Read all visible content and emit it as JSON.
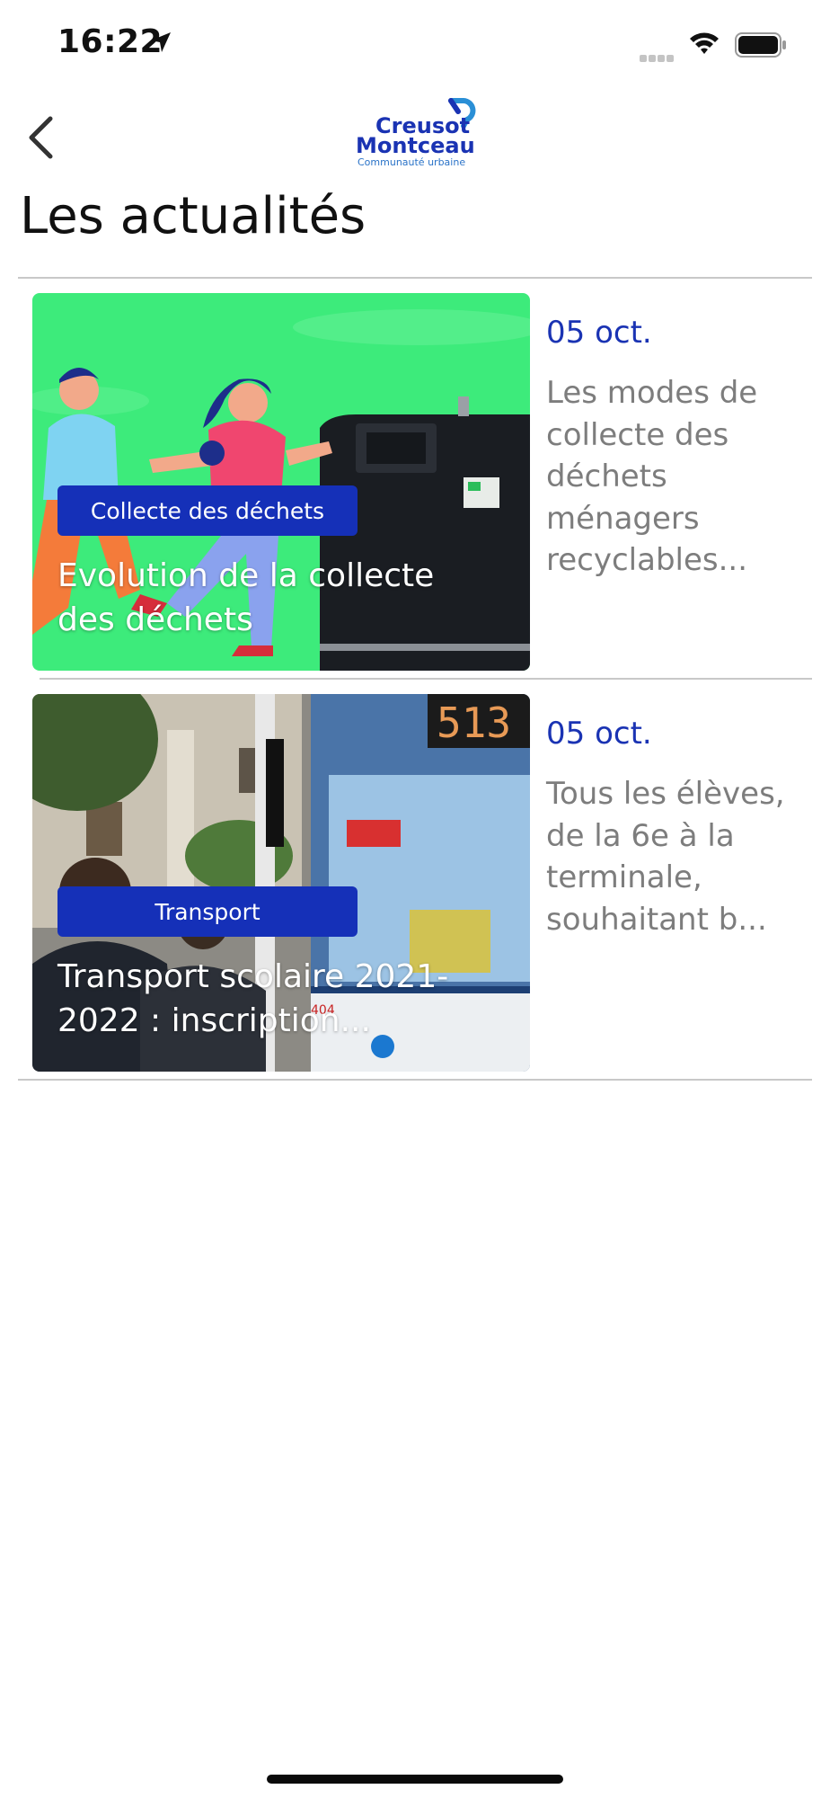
{
  "status_bar": {
    "time": "16:22",
    "icons": [
      "location-arrow-icon",
      "cellular-signal-icon",
      "wifi-icon",
      "battery-icon"
    ]
  },
  "nav": {
    "back_icon": "chevron-left-icon",
    "logo": {
      "line1": "Creusot",
      "line2": "Montceau",
      "line3": "Communauté urbaine"
    }
  },
  "page": {
    "title": "Les actualités"
  },
  "news": [
    {
      "category": "Collecte des déchets",
      "title": "Evolution de la collecte des déchets",
      "date": "05 oct.",
      "excerpt": "Les modes de collecte des déchets ménagers recyclables..."
    },
    {
      "category": "Transport",
      "title": "Transport scolaire 2021-2022 : inscription...",
      "date": "05 oct.",
      "excerpt": "Tous les élèves, de la 6e à la terminale, souhaitant b...",
      "bus_number": "513",
      "bus_plate": "404"
    }
  ],
  "colors": {
    "accent": "#1530b8",
    "date": "#1a33b3",
    "excerpt": "#7d7d7d",
    "divider": "#c8c8c8",
    "illustration_green": "#3deb7b"
  }
}
